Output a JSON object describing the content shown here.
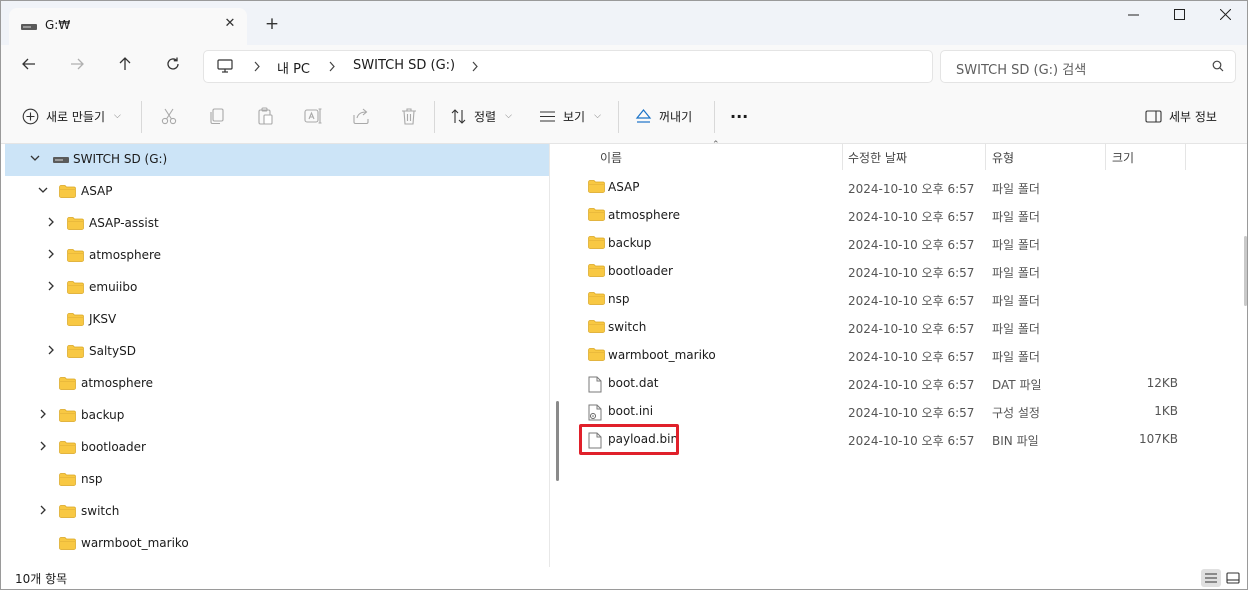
{
  "window": {
    "tab_title": "G:₩",
    "tab_close_glyph": "✕",
    "new_tab_glyph": "+",
    "controls": {
      "minimize": "—",
      "maximize": "☐",
      "close": "✕"
    }
  },
  "nav": {
    "breadcrumbs": [
      "내 PC",
      "SWITCH SD (G:)"
    ],
    "search_placeholder": "SWITCH SD (G:) 검색"
  },
  "toolbar": {
    "new_label": "새로 만들기",
    "sort_label": "정렬",
    "view_label": "보기",
    "eject_label": "꺼내기",
    "more_label": "···",
    "details_label": "세부 정보"
  },
  "tree": {
    "root": "SWITCH SD (G:)",
    "items": [
      {
        "label": "ASAP"
      },
      {
        "label": "ASAP-assist"
      },
      {
        "label": "atmosphere"
      },
      {
        "label": "emuiibo"
      },
      {
        "label": "JKSV"
      },
      {
        "label": "SaltySD"
      },
      {
        "label": "atmosphere"
      },
      {
        "label": "backup"
      },
      {
        "label": "bootloader"
      },
      {
        "label": "nsp"
      },
      {
        "label": "switch"
      },
      {
        "label": "warmboot_mariko"
      }
    ]
  },
  "columns": {
    "name": "이름",
    "date": "수정한 날짜",
    "type": "유형",
    "size": "크기"
  },
  "files": [
    {
      "name": "ASAP",
      "date": "2024-10-10 오후 6:57",
      "type": "파일 폴더",
      "size": "",
      "kind": "folder-icon"
    },
    {
      "name": "atmosphere",
      "date": "2024-10-10 오후 6:57",
      "type": "파일 폴더",
      "size": "",
      "kind": "folder-icon"
    },
    {
      "name": "backup",
      "date": "2024-10-10 오후 6:57",
      "type": "파일 폴더",
      "size": "",
      "kind": "folder-icon"
    },
    {
      "name": "bootloader",
      "date": "2024-10-10 오후 6:57",
      "type": "파일 폴더",
      "size": "",
      "kind": "folder-icon"
    },
    {
      "name": "nsp",
      "date": "2024-10-10 오후 6:57",
      "type": "파일 폴더",
      "size": "",
      "kind": "folder-icon"
    },
    {
      "name": "switch",
      "date": "2024-10-10 오후 6:57",
      "type": "파일 폴더",
      "size": "",
      "kind": "folder-icon"
    },
    {
      "name": "warmboot_mariko",
      "date": "2024-10-10 오후 6:57",
      "type": "파일 폴더",
      "size": "",
      "kind": "folder-icon"
    },
    {
      "name": "boot.dat",
      "date": "2024-10-10 오후 6:57",
      "type": "DAT 파일",
      "size": "12KB",
      "kind": "file-icon"
    },
    {
      "name": "boot.ini",
      "date": "2024-10-10 오후 6:57",
      "type": "구성 설정",
      "size": "1KB",
      "kind": "settings-file-icon"
    },
    {
      "name": "payload.bin",
      "date": "2024-10-10 오후 6:57",
      "type": "BIN 파일",
      "size": "107KB",
      "kind": "file-icon"
    }
  ],
  "status": {
    "count": "10개 항목"
  },
  "colors": {
    "selection": "#cce4f7",
    "highlight_box": "#e0202a",
    "folder": "#f8c843"
  }
}
